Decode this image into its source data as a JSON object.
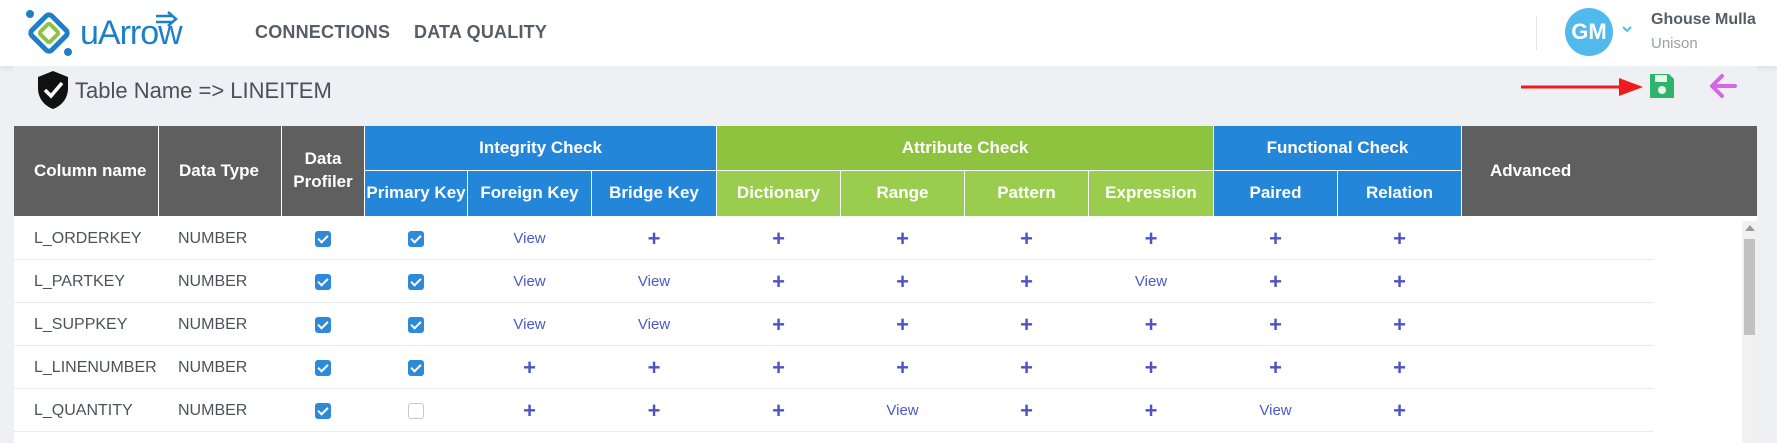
{
  "header": {
    "logo_text": "uArrow",
    "nav": [
      {
        "label": "CONNECTIONS"
      },
      {
        "label": "DATA QUALITY"
      }
    ],
    "user": {
      "initials": "GM",
      "name": "Ghouse Mulla",
      "org": "Unison"
    }
  },
  "subheader": {
    "table_name": "Table Name => LINEITEM"
  },
  "table": {
    "headers": {
      "column_name": "Column name",
      "data_type": "Data Type",
      "data_profiler": "Data Profiler",
      "integrity_check": "Integrity Check",
      "attribute_check": "Attribute Check",
      "functional_check": "Functional Check",
      "advanced": "Advanced",
      "primary_key": "Primary Key",
      "foreign_key": "Foreign Key",
      "bridge_key": "Bridge Key",
      "dictionary": "Dictionary",
      "range": "Range",
      "pattern": "Pattern",
      "expression": "Expression",
      "paired": "Paired",
      "relation": "Relation"
    },
    "rows": [
      {
        "name": "L_ORDERKEY",
        "type": "NUMBER",
        "profiler": true,
        "primary_key": true,
        "foreign_key": "View",
        "bridge_key": "+",
        "dictionary": "+",
        "range": "+",
        "pattern": "+",
        "expression": "+",
        "paired": "+",
        "relation": "+"
      },
      {
        "name": "L_PARTKEY",
        "type": "NUMBER",
        "profiler": true,
        "primary_key": true,
        "foreign_key": "View",
        "bridge_key": "View",
        "dictionary": "+",
        "range": "+",
        "pattern": "+",
        "expression": "View",
        "paired": "+",
        "relation": "+"
      },
      {
        "name": "L_SUPPKEY",
        "type": "NUMBER",
        "profiler": true,
        "primary_key": true,
        "foreign_key": "View",
        "bridge_key": "View",
        "dictionary": "+",
        "range": "+",
        "pattern": "+",
        "expression": "+",
        "paired": "+",
        "relation": "+"
      },
      {
        "name": "L_LINENUMBER",
        "type": "NUMBER",
        "profiler": true,
        "primary_key": true,
        "foreign_key": "+",
        "bridge_key": "+",
        "dictionary": "+",
        "range": "+",
        "pattern": "+",
        "expression": "+",
        "paired": "+",
        "relation": "+"
      },
      {
        "name": "L_QUANTITY",
        "type": "NUMBER",
        "profiler": true,
        "primary_key": false,
        "foreign_key": "+",
        "bridge_key": "+",
        "dictionary": "+",
        "range": "View",
        "pattern": "+",
        "expression": "+",
        "paired": "View",
        "relation": "+"
      }
    ]
  },
  "colors": {
    "header_gray": "#5f5f5f",
    "integrity_blue": "#2486d8",
    "attribute_green": "#8dc33e",
    "save_green": "#2fb56b",
    "back_pink": "#d567e6",
    "annotation_red": "#ee1c1c"
  },
  "icons": {
    "logo": "uarrow-logo-icon",
    "shield": "shield-check-icon",
    "save": "floppy-disk-icon",
    "back": "arrow-left-icon",
    "annotation": "red-arrow-icon"
  }
}
